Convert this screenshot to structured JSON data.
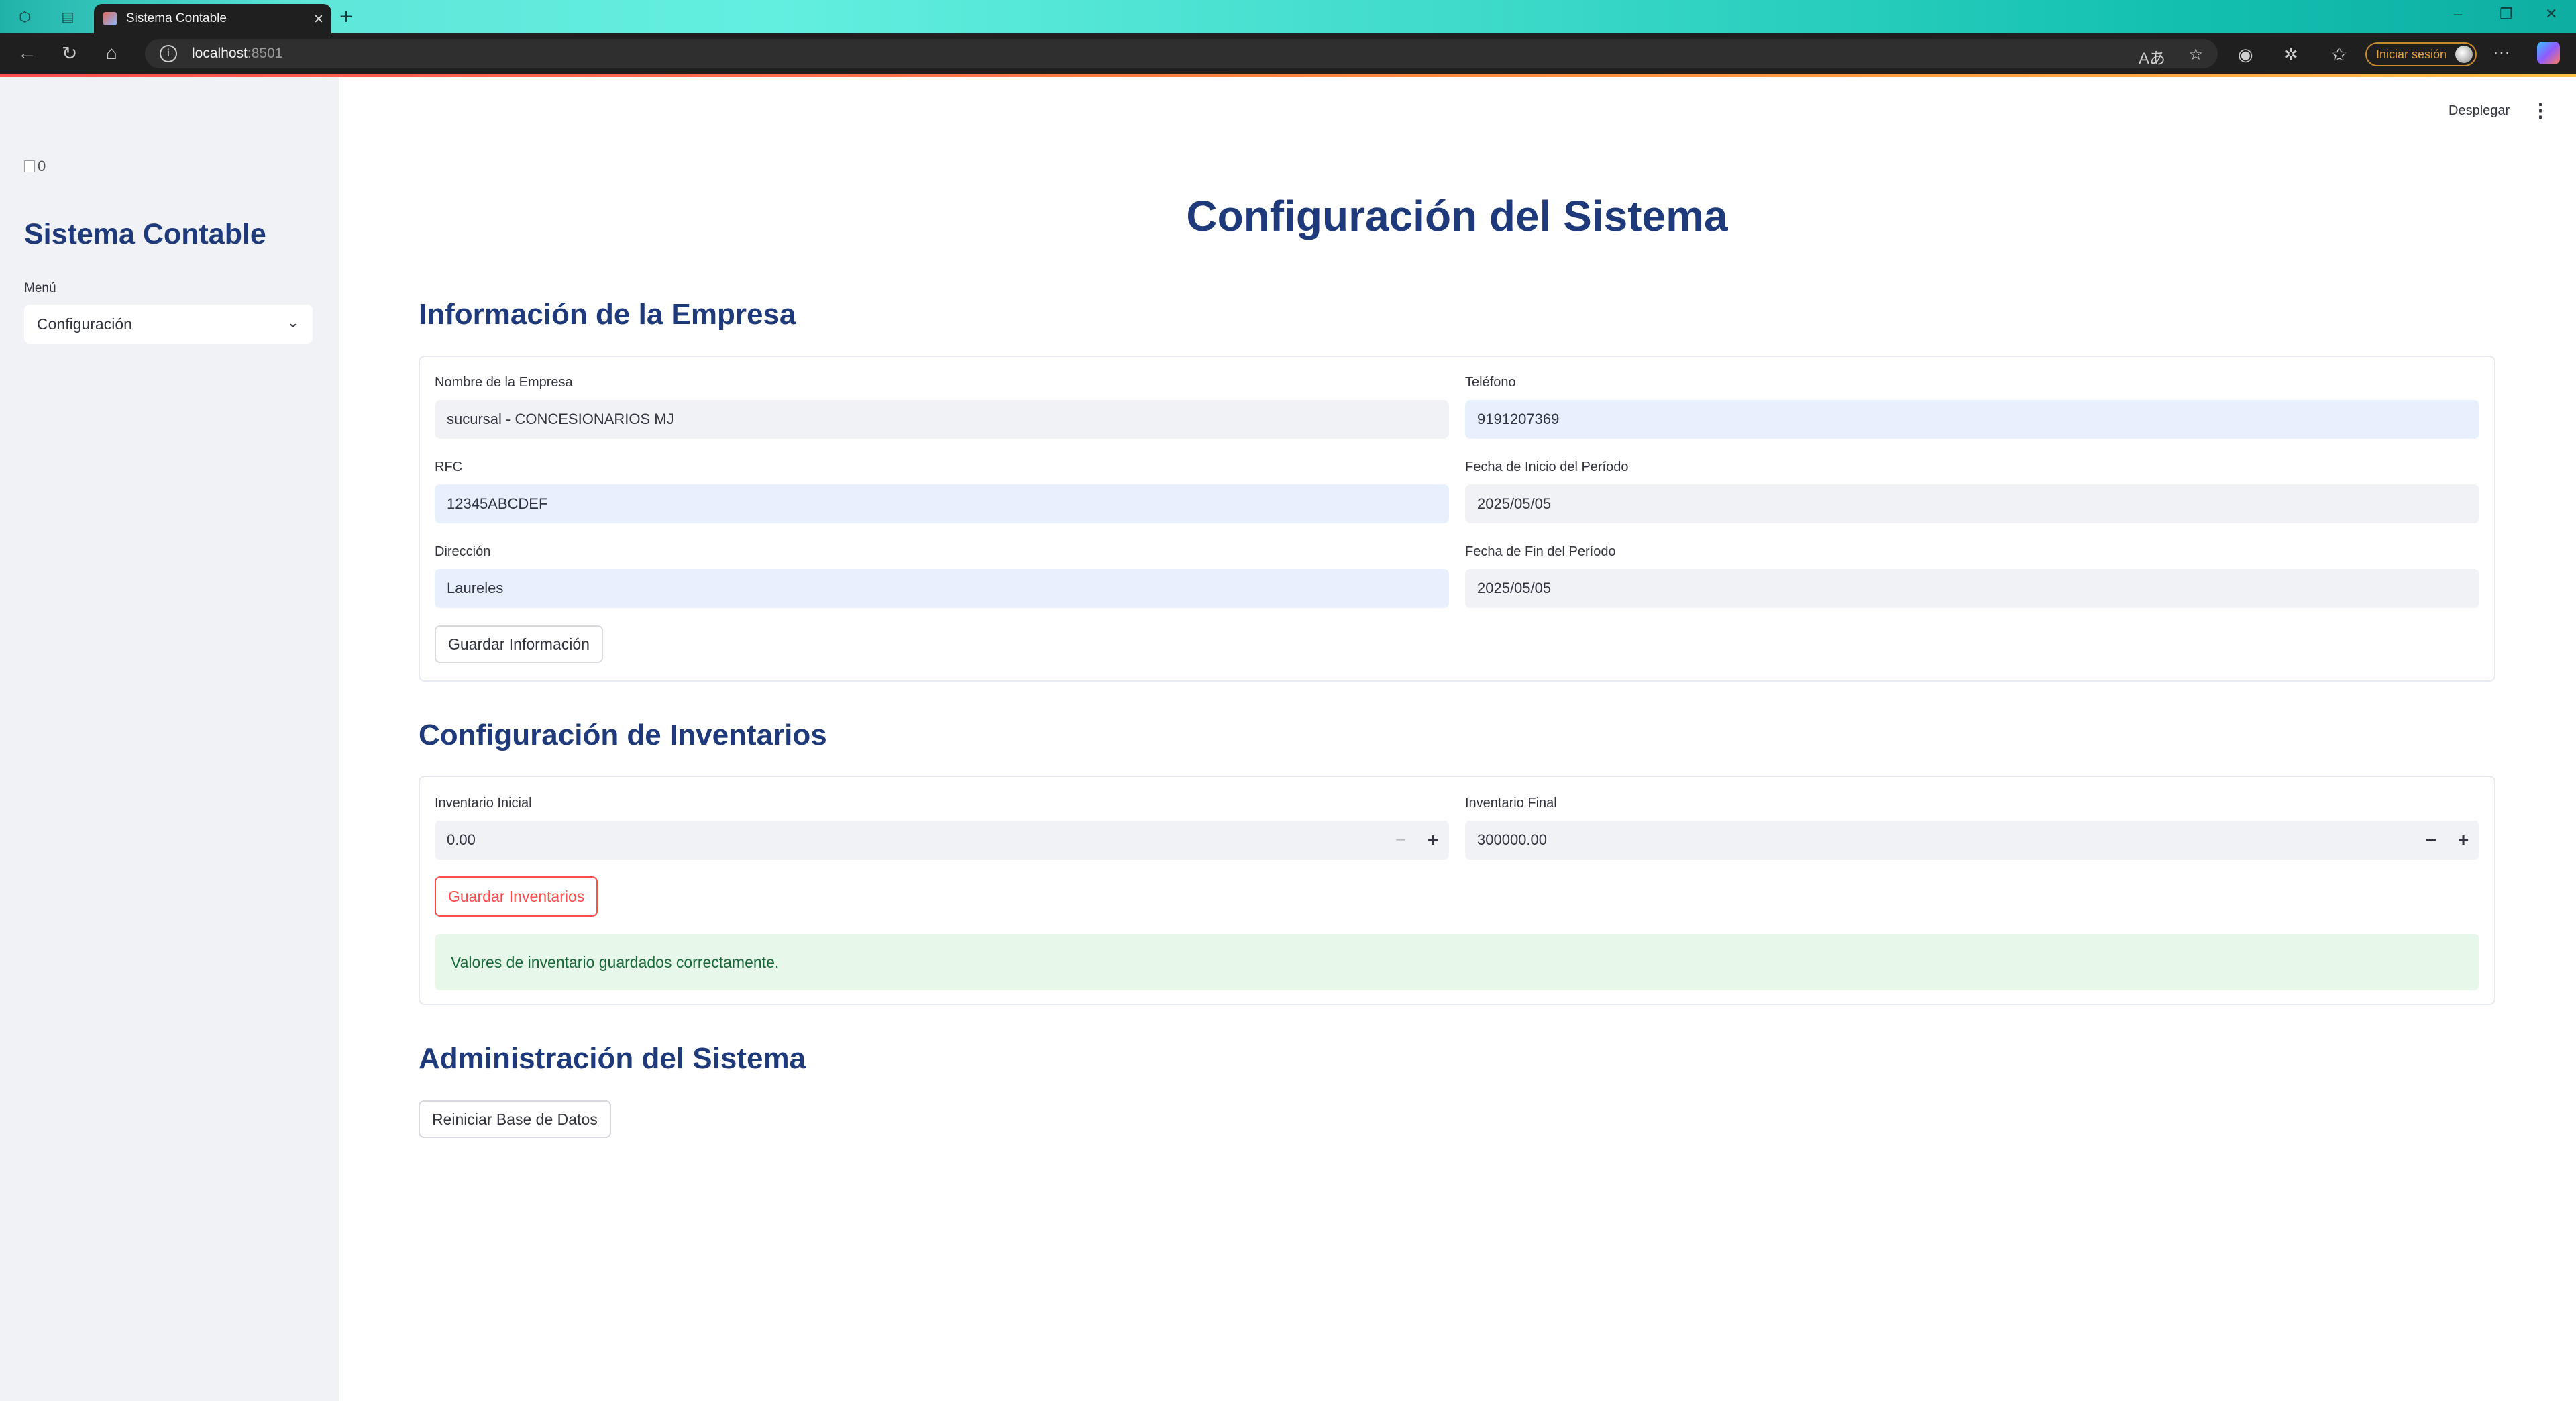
{
  "browser": {
    "tab_title": "Sistema Contable",
    "url_host": "localhost",
    "url_port": ":8501",
    "signin_label": "Iniciar sesión"
  },
  "header": {
    "deploy_label": "Desplegar"
  },
  "sidebar": {
    "logo_alt": "0",
    "title": "Sistema Contable",
    "menu_label": "Menú",
    "menu_selected": "Configuración"
  },
  "main": {
    "page_title": "Configuración del Sistema",
    "empresa": {
      "heading": "Información de la Empresa",
      "nombre_label": "Nombre de la Empresa",
      "nombre_value": "sucursal - CONCESIONARIOS MJ",
      "telefono_label": "Teléfono",
      "telefono_value": "9191207369",
      "rfc_label": "RFC",
      "rfc_value": "12345ABCDEF",
      "fecha_inicio_label": "Fecha de Inicio del Período",
      "fecha_inicio_value": "2025/05/05",
      "direccion_label": "Dirección",
      "direccion_value": "Laureles",
      "fecha_fin_label": "Fecha de Fin del Período",
      "fecha_fin_value": "2025/05/05",
      "save_label": "Guardar Información"
    },
    "inventarios": {
      "heading": "Configuración de Inventarios",
      "inicial_label": "Inventario Inicial",
      "inicial_value": "0.00",
      "final_label": "Inventario Final",
      "final_value": "300000.00",
      "save_label": "Guardar Inventarios",
      "success_message": "Valores de inventario guardados correctamente."
    },
    "admin": {
      "heading": "Administración del Sistema",
      "reset_label": "Reiniciar Base de Datos"
    }
  },
  "colors": {
    "heading": "#1e3a7b",
    "sidebar_bg": "#f0f2f6",
    "primary": "#ff4b4b",
    "success_bg": "#e7f7ea",
    "success_text": "#17693a"
  }
}
